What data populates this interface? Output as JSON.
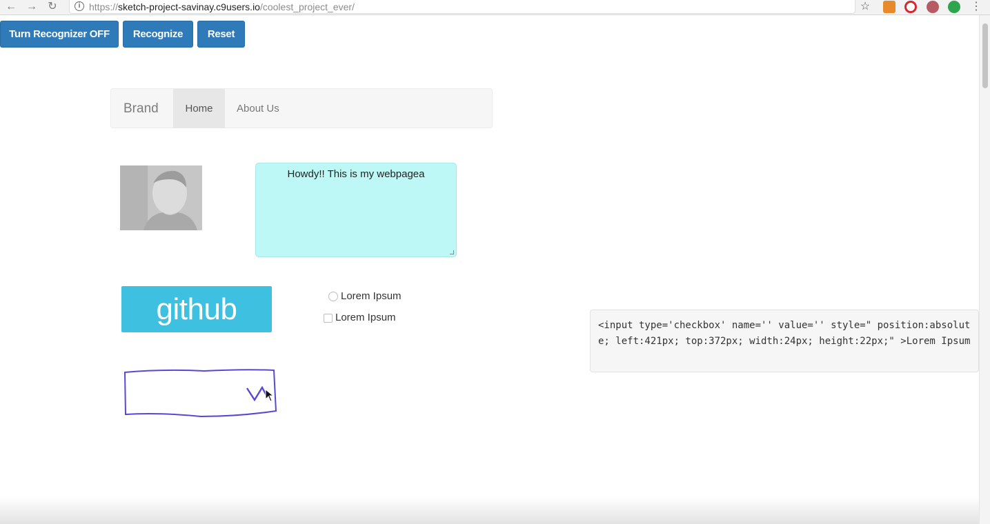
{
  "browser": {
    "url_scheme": "https://",
    "url_host": "sketch-project-savinay.c9users.io",
    "url_path": "/coolest_project_ever/"
  },
  "toolbar": {
    "recognizer_off_label": "Turn Recognizer OFF",
    "recognize_label": "Recognize",
    "reset_label": "Reset"
  },
  "navbar": {
    "brand": "Brand",
    "home": "Home",
    "about": "About Us"
  },
  "textarea": {
    "value": "Howdy!! This is my webpagea"
  },
  "github_button": {
    "label": "github"
  },
  "options": {
    "radio_label": "Lorem Ipsum",
    "checkbox_label": "Lorem Ipsum"
  },
  "code": {
    "text": "<input type='checkbox' name='' value='' style=\" position:absolute; left:421px; top:372px; width:24px; height:22px;\" >Lorem Ipsum"
  },
  "colors": {
    "button_blue": "#2f7ab8",
    "textarea_bg": "#bdf8f6",
    "github_bg": "#3ec0e0",
    "sketch_stroke": "#5548d8"
  },
  "icons": [
    "back-icon",
    "forward-icon",
    "reload-icon",
    "info-icon",
    "star-icon",
    "menu-icon"
  ]
}
